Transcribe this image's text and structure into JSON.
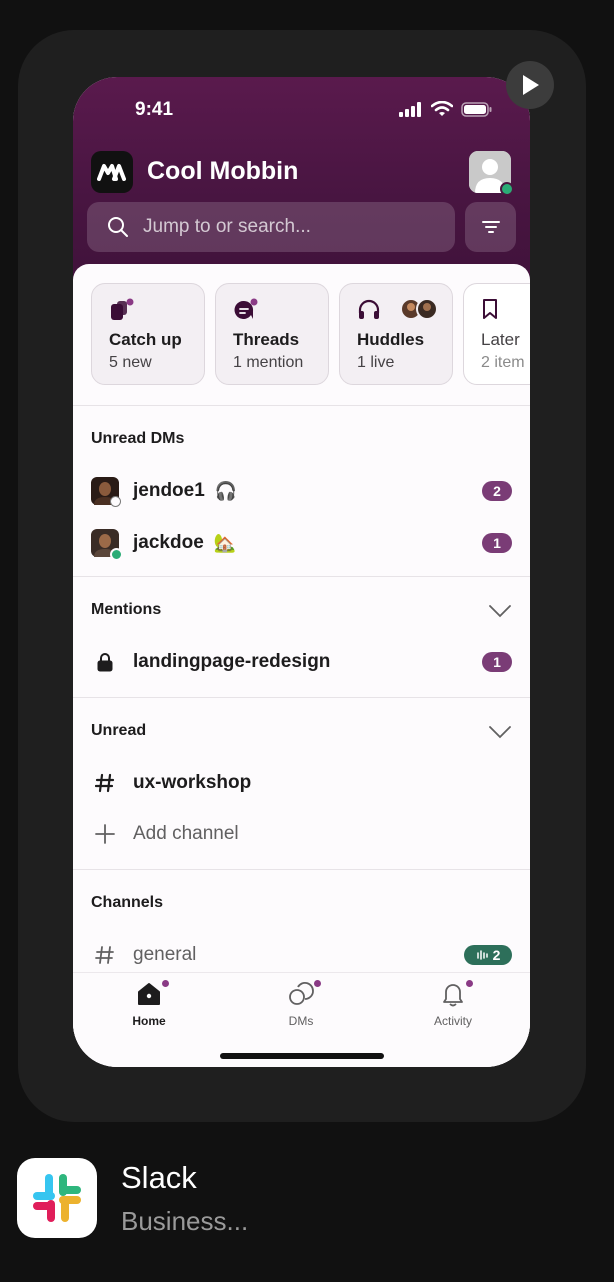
{
  "status_bar": {
    "time": "9:41"
  },
  "workspace": {
    "name": "Cool Mobbin"
  },
  "search": {
    "placeholder": "Jump to or search..."
  },
  "quick_cards": [
    {
      "title": "Catch up",
      "subtitle": "5 new"
    },
    {
      "title": "Threads",
      "subtitle": "1 mention"
    },
    {
      "title": "Huddles",
      "subtitle": "1 live"
    },
    {
      "title": "Later",
      "subtitle": "2 item"
    }
  ],
  "unread_dms": {
    "title": "Unread DMs",
    "items": [
      {
        "name": "jendoe1",
        "emoji": "🎧",
        "badge": "2"
      },
      {
        "name": "jackdoe",
        "emoji": "🏡",
        "badge": "1"
      }
    ]
  },
  "mentions": {
    "title": "Mentions",
    "items": [
      {
        "name": "landingpage-redesign",
        "badge": "1"
      }
    ]
  },
  "unread": {
    "title": "Unread",
    "items": [
      {
        "name": "ux-workshop"
      }
    ],
    "add_label": "Add channel"
  },
  "channels": {
    "title": "Channels",
    "items": [
      {
        "name": "general",
        "badge": "2"
      }
    ]
  },
  "tabs": [
    {
      "label": "Home"
    },
    {
      "label": "DMs"
    },
    {
      "label": "Activity"
    }
  ],
  "app": {
    "name": "Slack",
    "category": "Business..."
  },
  "colors": {
    "header": "#4a1640",
    "badge": "#7a3c76",
    "online": "#2bac76",
    "fab": "#3b0d36"
  }
}
